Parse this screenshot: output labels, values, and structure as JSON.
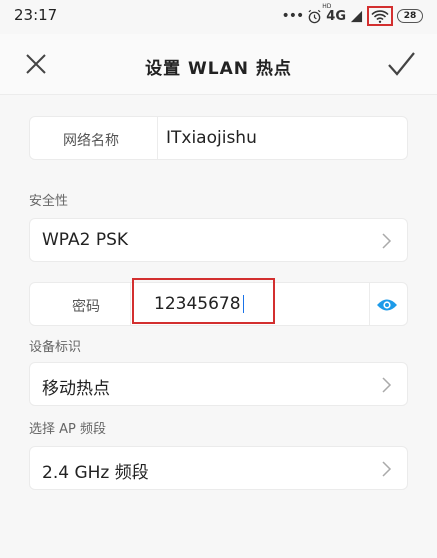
{
  "status_bar": {
    "time": "23:17",
    "dots": "•••",
    "network": "4G",
    "network_sup": "HD",
    "battery": "28"
  },
  "nav": {
    "title": "设置 WLAN 热点"
  },
  "form": {
    "name_label": "网络名称",
    "name_value": "ITxiaojishu",
    "security_section": "安全性",
    "security_value": "WPA2 PSK",
    "password_label": "密码",
    "password_value": "12345678",
    "device_section": "设备标识",
    "device_value": "移动热点",
    "band_section": "选择 AP 频段",
    "band_value": "2.4 GHz 频段"
  },
  "colors": {
    "highlight": "#d32f2f",
    "eye_icon": "#1e9be9"
  }
}
